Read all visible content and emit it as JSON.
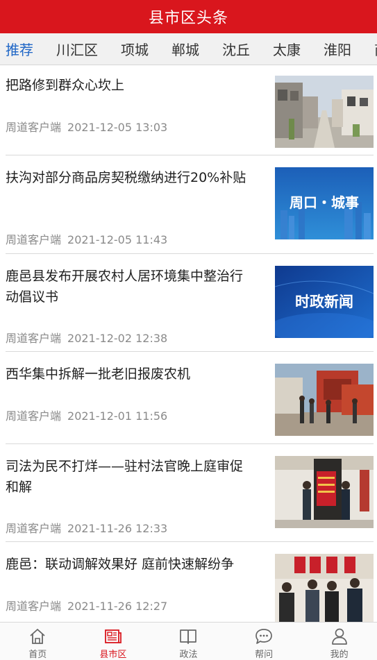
{
  "header": {
    "title": "县市区头条"
  },
  "tabs": [
    {
      "label": "推荐",
      "active": true
    },
    {
      "label": "川汇区"
    },
    {
      "label": "项城"
    },
    {
      "label": "郸城"
    },
    {
      "label": "沈丘"
    },
    {
      "label": "太康"
    },
    {
      "label": "淮阳"
    },
    {
      "label": "商水"
    }
  ],
  "articles": [
    {
      "title": "把路修到群众心坎上",
      "source": "周道客户端",
      "time": "2021-12-05 13:03",
      "thumb": "village-street-photo"
    },
    {
      "title": "扶沟对部分商品房契税缴纳进行20%补贴",
      "source": "周道客户端",
      "time": "2021-12-05 11:43",
      "thumb": "zhoukou-city-banner",
      "thumb_text": "周口・城事"
    },
    {
      "title": "鹿邑县发布开展农村人居环境集中整治行动倡议书",
      "source": "周道客户端",
      "time": "2021-12-02 12:38",
      "thumb": "politics-news-banner",
      "thumb_text": "时政新闻"
    },
    {
      "title": "西华集中拆解一批老旧报废农机",
      "source": "周道客户端",
      "time": "2021-12-01 11:56",
      "thumb": "farm-machinery-photo"
    },
    {
      "title": "司法为民不打烊——驻村法官晚上庭审促和解",
      "source": "周道客户端",
      "time": "2021-11-26 12:33",
      "thumb": "court-banner-photo"
    },
    {
      "title": "鹿邑：联动调解效果好 庭前快速解纷争",
      "source": "周道客户端",
      "time": "2021-11-26 12:27",
      "thumb": "mediation-meeting-photo"
    }
  ],
  "bottom_nav": [
    {
      "label": "首页",
      "icon": "home-icon"
    },
    {
      "label": "县市区",
      "icon": "newspaper-icon",
      "active": true
    },
    {
      "label": "政法",
      "icon": "book-icon"
    },
    {
      "label": "帮问",
      "icon": "chat-bubble-icon"
    },
    {
      "label": "我的",
      "icon": "user-icon"
    }
  ],
  "colors": {
    "brand_red": "#d9161d",
    "tab_active_blue": "#1f66c6",
    "meta_gray": "#8a8a8a"
  }
}
